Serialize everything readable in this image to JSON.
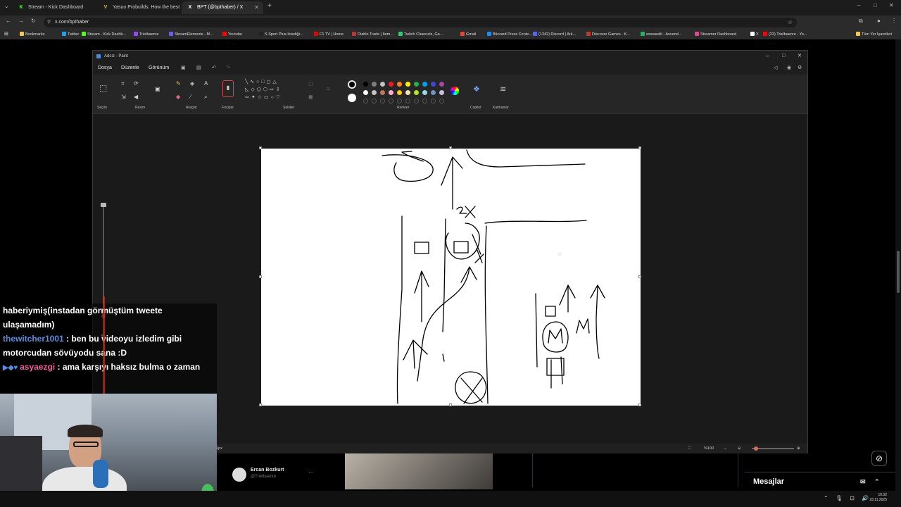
{
  "browser": {
    "tabs": [
      {
        "title": "Stream - Kick Dashboard",
        "icon": "kick-icon",
        "color": "#53fc18",
        "glyph": "K"
      },
      {
        "title": "Yasuo Probuilds: How the best",
        "icon": "v-icon",
        "color": "#d9b34a",
        "glyph": "V"
      },
      {
        "title": "BPT (@bpthaber) / X",
        "icon": "x-logo-icon",
        "color": "#ffffff",
        "glyph": "X"
      }
    ],
    "url": "x.com/bpthaber",
    "bookmarks": [
      {
        "label": "Bookmarks",
        "color": "#f2c94c"
      },
      {
        "label": "Twitter",
        "color": "#1da1f2"
      },
      {
        "label": "Stream - Kick Dashb...",
        "color": "#53fc18"
      },
      {
        "label": "Trielbaenre",
        "color": "#9146ff"
      },
      {
        "label": "StreamElements - M...",
        "color": "#6b5bff"
      },
      {
        "label": "Youtube",
        "color": "#ff0000"
      },
      {
        "label": "S Sport Plus-İstediği...",
        "color": "#222222"
      },
      {
        "label": "F1 TV | Home",
        "color": "#e10600"
      },
      {
        "label": "Diablo Trade | Item...",
        "color": "#b33"
      },
      {
        "label": "Twitch Channels, Ga...",
        "color": "#2ecc71"
      },
      {
        "label": "Gmail",
        "color": "#ea4335"
      },
      {
        "label": "Blizzard Press Cente...",
        "color": "#148eff"
      },
      {
        "label": "(1342) Discord | Ark...",
        "color": "#5865f2"
      },
      {
        "label": "Discover Games - K...",
        "color": "#c0392b"
      },
      {
        "label": "wowaudit - Ascend...",
        "color": "#27ae60"
      },
      {
        "label": "Streamer Dashboard",
        "color": "#e84393"
      },
      {
        "label": "X",
        "color": "#ffffff"
      },
      {
        "label": "(23) Trielbaenre - Yo...",
        "color": "#ff0000"
      }
    ],
    "all_bookmarks": "Tüm Yer İşaretleri"
  },
  "paint": {
    "title": "Adsız - Paint",
    "menu": [
      "Dosya",
      "Düzenle",
      "Görünüm"
    ],
    "groups": [
      "Seçim",
      "Resim",
      "Araçlar",
      "Fırçalar",
      "Şekiller",
      "Renkler",
      "Copilot",
      "Katmanlar"
    ],
    "colors_row1": [
      "#000000",
      "#7f7f7f",
      "#c3c3c3",
      "#ed1c24",
      "#ff7f27",
      "#fff200",
      "#22b14c",
      "#00a2e8",
      "#3f48cc",
      "#a349a4"
    ],
    "colors_row2": [
      "#ffffff",
      "#c3c3c3",
      "#b97a57",
      "#ffaec9",
      "#ffc90e",
      "#efe4b0",
      "#b5e61d",
      "#99d9ea",
      "#7092be",
      "#c8bfe7"
    ],
    "status_px": "1px",
    "zoom": "%100"
  },
  "chat": [
    {
      "user": "",
      "text": "haberiymiş(instadan görmüştüm tweete ulaşamadım)"
    },
    {
      "user": "thewitcher1001",
      "text": " : ben bu videoyu izledim gibi motorcudan sövüyodu sana :D"
    },
    {
      "user": "asyaezgi",
      "text": " : ama karşıyı haksız bulma o zaman"
    }
  ],
  "tweet": {
    "author_name": "Ercan Bozkurt",
    "author_handle": "@Trielbaenre",
    "more": "···"
  },
  "messages_label": "Mesajlar",
  "clock": {
    "time": "10:32",
    "date": "23.11.2025"
  }
}
